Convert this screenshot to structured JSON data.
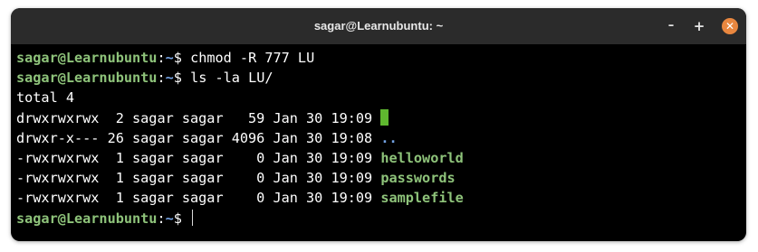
{
  "window": {
    "title": "sagar@Learnubuntu: ~",
    "buttons": {
      "minimize": "–",
      "maximize": "+",
      "close": "✕"
    },
    "close_color": "#e9873f"
  },
  "prompt": {
    "user_host": "sagar@Learnubuntu",
    "sep": ":",
    "path": "~",
    "symbol": "$ "
  },
  "commands": [
    "chmod -R 777 LU",
    "ls -la LU/"
  ],
  "output": {
    "total": "total 4",
    "entries": [
      {
        "perms_meta": "drwxrwxrwx  2 sagar sagar   59 Jan 30 19:09 ",
        "name": "."
      },
      {
        "perms_meta": "drwxr-x--- 26 sagar sagar 4096 Jan 30 19:08 ",
        "name": ".."
      },
      {
        "perms_meta": "-rwxrwxrwx  1 sagar sagar    0 Jan 30 19:09 ",
        "name": "helloworld"
      },
      {
        "perms_meta": "-rwxrwxrwx  1 sagar sagar    0 Jan 30 19:09 ",
        "name": "passwords"
      },
      {
        "perms_meta": "-rwxrwxrwx  1 sagar sagar    0 Jan 30 19:09 ",
        "name": "samplefile"
      }
    ]
  },
  "colors": {
    "user_host": "#8ec37a",
    "path": "#74a3e5",
    "directory": "#74a3e5",
    "executable": "#8ec37a",
    "background": "#000000",
    "titlebar": "#2b2b2b"
  }
}
